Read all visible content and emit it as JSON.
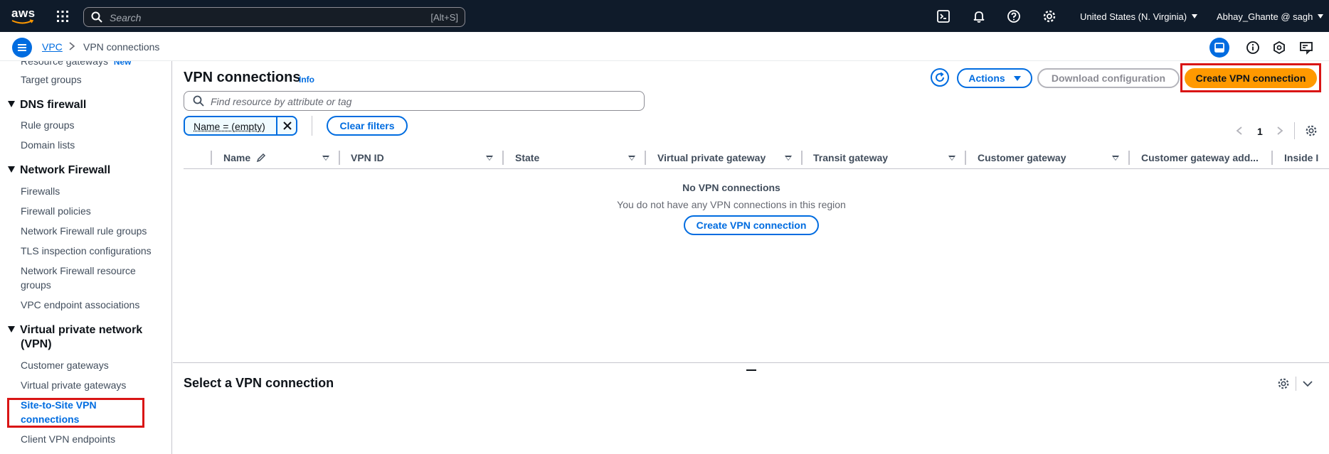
{
  "topbar": {
    "logo_text": "aws",
    "search_placeholder": "Search",
    "search_shortcut": "[Alt+S]",
    "region": "United States (N. Virginia)",
    "user": "Abhay_Ghante @ sagh"
  },
  "breadcrumb": {
    "items": [
      "VPC",
      "VPN connections"
    ]
  },
  "sidebar": {
    "cut_item": "Resource gateways",
    "cut_badge": "New",
    "target_groups": "Target groups",
    "dns_firewall": {
      "heading": "DNS firewall",
      "items": [
        "Rule groups",
        "Domain lists"
      ]
    },
    "network_firewall": {
      "heading": "Network Firewall",
      "items": [
        "Firewalls",
        "Firewall policies",
        "Network Firewall rule groups",
        "TLS inspection configurations",
        "Network Firewall resource",
        "groups",
        "VPC endpoint associations"
      ]
    },
    "vpn": {
      "heading_line1": "Virtual private network",
      "heading_line2": "(VPN)",
      "items": [
        "Customer gateways",
        "Virtual private gateways"
      ],
      "active_line1": "Site-to-Site VPN",
      "active_line2": "connections",
      "last": "Client VPN endpoints"
    }
  },
  "main": {
    "title": "VPN connections",
    "info": "Info",
    "actions_label": "Actions",
    "download_label": "Download configuration",
    "create_label": "Create VPN connection",
    "find_placeholder": "Find resource by attribute or tag",
    "token_label": "Name = (empty)",
    "clear_filters": "Clear filters",
    "page_number": "1",
    "columns": [
      "Name",
      "VPN ID",
      "State",
      "Virtual private gateway",
      "Transit gateway",
      "Customer gateway",
      "Customer gateway add...",
      "Inside I"
    ],
    "empty_title": "No VPN connections",
    "empty_sub": "You do not have any VPN connections in this region",
    "empty_create": "Create VPN connection",
    "bottom_title": "Select a VPN connection"
  },
  "colors": {
    "topbar_bg": "#0f1b2a",
    "accent": "#006ce0",
    "primary_button": "#ff9900",
    "highlight": "#d91515"
  },
  "icons": [
    "search-icon",
    "apps-grid-icon",
    "cloudshell-icon",
    "bell-icon",
    "help-icon",
    "gear-icon",
    "menu-icon",
    "chevron-right-icon",
    "panel-icon",
    "info-icon",
    "hexagon-icon",
    "feedback-icon",
    "refresh-icon",
    "close-icon",
    "pencil-icon",
    "chevron-left-icon",
    "chevron-down-icon"
  ]
}
